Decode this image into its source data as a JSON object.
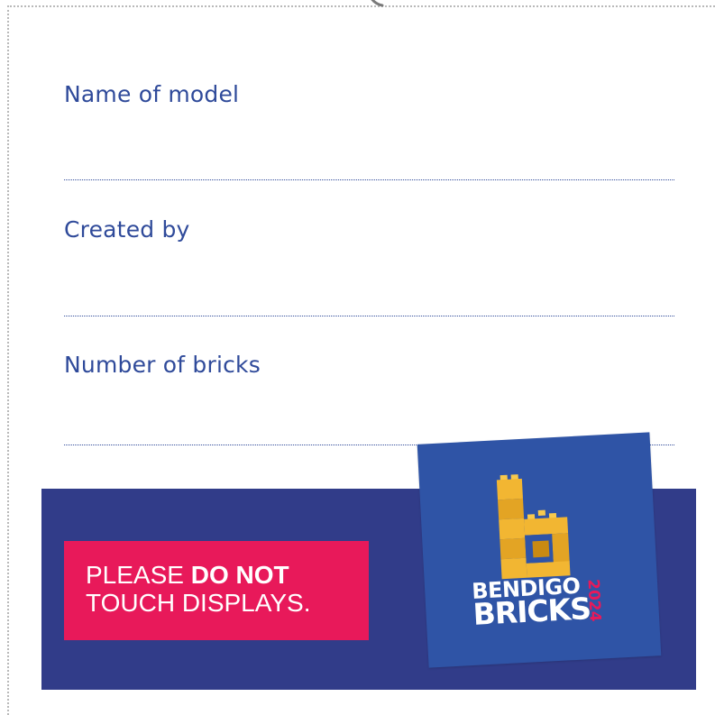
{
  "fields": [
    {
      "label": "Name of model"
    },
    {
      "label": "Created by"
    },
    {
      "label": "Number of bricks"
    }
  ],
  "notice": {
    "prefix": "PLEASE ",
    "emphasis": "DO NOT",
    "rest": "TOUCH DISPLAYS."
  },
  "logo": {
    "line1": "BENDIGO",
    "line2": "BRICKS",
    "year": "2024"
  },
  "colors": {
    "text_blue": "#2f4a9a",
    "banner_navy": "#313c89",
    "notice_pink": "#e8195a",
    "logo_blue": "#2f54a6",
    "brick_yellow": "#f2b632"
  }
}
